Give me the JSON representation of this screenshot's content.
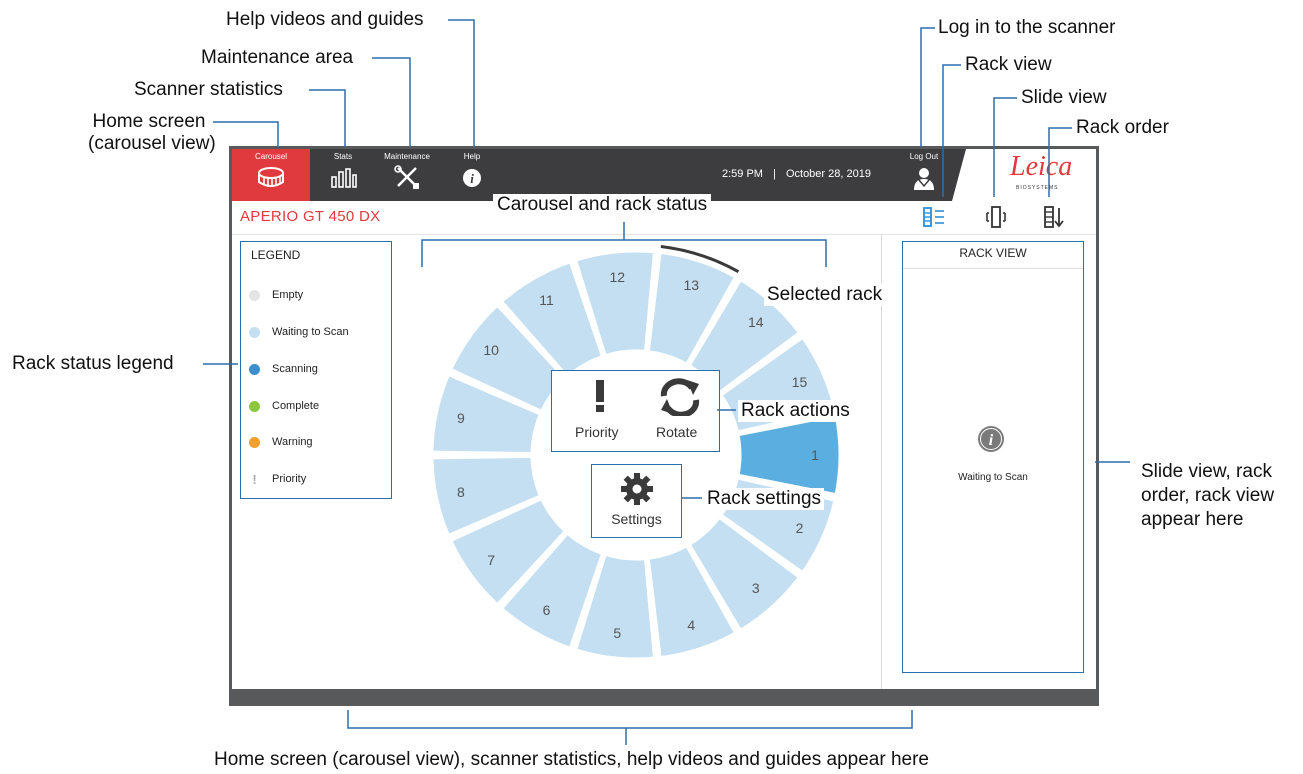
{
  "callouts": {
    "help_videos": "Help videos and guides",
    "maintenance_area": "Maintenance  area",
    "scanner_statistics": "Scanner statistics",
    "home_screen_line1": "Home screen",
    "home_screen_line2": "(carousel view)",
    "log_in": "Log in to the scanner",
    "rack_view": "Rack view",
    "slide_view": "Slide view",
    "rack_order": "Rack order",
    "carousel_status": "Carousel and rack status",
    "selected_rack": "Selected rack",
    "rack_actions": "Rack actions",
    "rack_settings": "Rack settings",
    "rack_status_legend": "Rack status legend",
    "right_panel_line1": "Slide view, rack",
    "right_panel_line2": "order, rack view",
    "right_panel_line3": "appear here",
    "bottom": "Home screen (carousel view), scanner statistics, help videos and guides appear here"
  },
  "nav": {
    "carousel": "Carousel",
    "stats": "Stats",
    "maintenance": "Maintenance",
    "help": "Help",
    "logout": "Log Out"
  },
  "header": {
    "time": "2:59 PM",
    "separator": "|",
    "date": "October 28, 2019",
    "logo": "Leica",
    "logo_sub": "BIOSYSTEMS",
    "product": "APERIO GT 450 DX"
  },
  "legend": {
    "title": "LEGEND",
    "items": [
      {
        "label": "Empty",
        "color": "#e4e4e4"
      },
      {
        "label": "Waiting to Scan",
        "color": "#c3dff1"
      },
      {
        "label": "Scanning",
        "color": "#3d8fcc"
      },
      {
        "label": "Complete",
        "color": "#8cc63f"
      },
      {
        "label": "Warning",
        "color": "#f0a030"
      },
      {
        "label": "Priority",
        "color": "#aaaaaa"
      }
    ]
  },
  "carousel": {
    "racks": [
      "1",
      "2",
      "3",
      "4",
      "5",
      "6",
      "7",
      "8",
      "9",
      "10",
      "11",
      "12",
      "13",
      "14",
      "15"
    ],
    "selected_rack": "13",
    "active_rack": "1",
    "colors": {
      "waiting": "#c3dff1",
      "active": "#5aaee0",
      "selected_arc": "#3a3a3a"
    }
  },
  "actions": {
    "priority": "Priority",
    "rotate": "Rotate",
    "settings": "Settings"
  },
  "rack_panel": {
    "title": "RACK VIEW",
    "status": "Waiting to Scan"
  },
  "colors": {
    "accent_red": "#e03a3e",
    "callout_blue": "#2a6fad",
    "topbar": "#3d3d40"
  }
}
